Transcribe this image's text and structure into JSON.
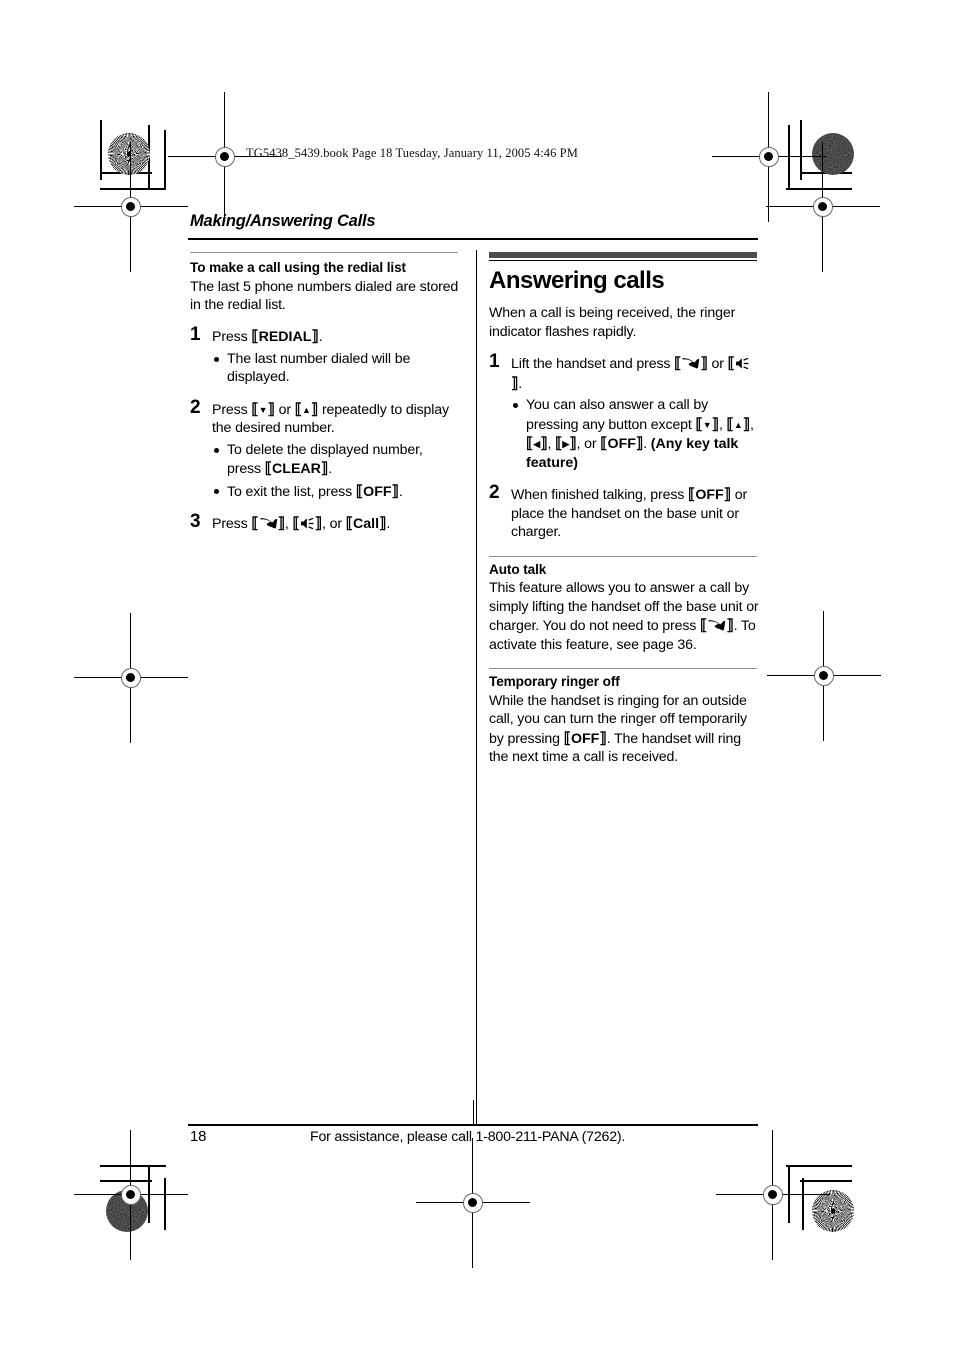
{
  "file_stamp": "TG5438_5439.book  Page 18  Tuesday, January 11, 2005  4:46 PM",
  "running_head": "Making/Answering Calls",
  "left_column": {
    "subhead": "To make a call using the redial list",
    "intro": "The last 5 phone numbers dialed are stored in the redial list.",
    "steps": [
      {
        "num": "1",
        "text_before": "Press ",
        "key": "REDIAL",
        "text_after": ".",
        "bullets": [
          {
            "text": "The last number dialed will be displayed."
          }
        ]
      },
      {
        "num": "2",
        "text_before": "Press ",
        "text_after": " repeatedly to display the desired number.",
        "key_down": "▼",
        "key_or": " or ",
        "key_up": "▲",
        "bullets": [
          {
            "text_before": "To delete the displayed number, press ",
            "key": "CLEAR",
            "text_after": "."
          },
          {
            "text_before": "To exit the list, press ",
            "key": "OFF",
            "text_after": "."
          }
        ]
      },
      {
        "num": "3",
        "text_before": "Press ",
        "icon_talk": "talk-handset-icon",
        "sep1": ", ",
        "icon_speaker": "speakerphone-icon",
        "sep2": ", or ",
        "key": "Call",
        "text_after": "."
      }
    ]
  },
  "right_column": {
    "section_title": "Answering calls",
    "intro": "When a call is being received, the ringer indicator flashes rapidly.",
    "steps": [
      {
        "num": "1",
        "text_before": "Lift the handset and press ",
        "icon_talk": "talk-handset-icon",
        "mid": " or ",
        "icon_speaker": "speakerphone-icon",
        "text_after": ".",
        "bullets": [
          {
            "text_before": "You can also answer a call by pressing any button except ",
            "key_down": "▼",
            "sep1": ", ",
            "key_up": "▲",
            "sep2": ", ",
            "key_left": "◀",
            "sep3": ", ",
            "key_right": "▶",
            "sep4": ", or ",
            "key_off": "OFF",
            "sep5": ". ",
            "bold_tail": "(Any key talk feature)"
          }
        ]
      },
      {
        "num": "2",
        "text_before": "When finished talking, press ",
        "key": "OFF",
        "text_after": " or place the handset on the base unit or charger."
      }
    ],
    "features": [
      {
        "heading": "Auto talk",
        "text_before": "This feature allows you to answer a call by simply lifting the handset off the base unit or charger. You do not need to press ",
        "icon_talk": "talk-handset-icon",
        "text_after": ". To activate this feature, see page 36."
      },
      {
        "heading": "Temporary ringer off",
        "text_before": "While the handset is ringing for an outside call, you can turn the ringer off temporarily by pressing ",
        "key": "OFF",
        "text_after": ". The handset will ring the next time a call is received."
      }
    ]
  },
  "footer": {
    "page_number": "18",
    "assistance": "For assistance, please call 1-800-211-PANA (7262)."
  },
  "prepress": {
    "halftone_circle": "halftone-registration-circle",
    "solid_circle": "solid-density-circle",
    "registration_target": "registration-target-icon"
  }
}
